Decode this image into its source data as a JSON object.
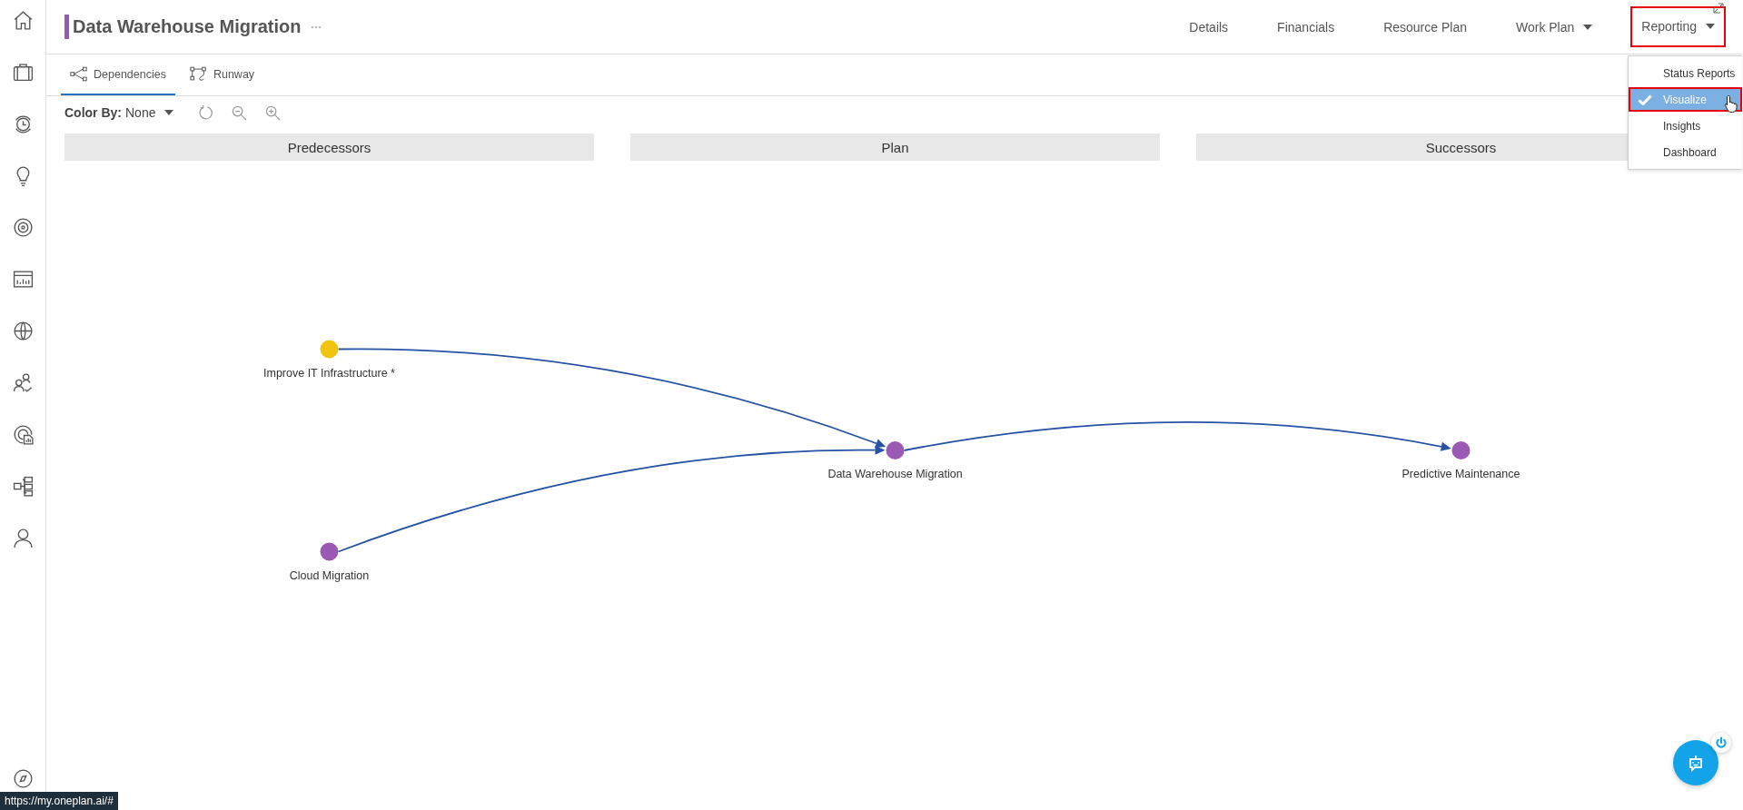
{
  "header": {
    "title": "Data Warehouse Migration"
  },
  "nav": [
    {
      "label": "Details",
      "dropdown": false,
      "highlighted": false
    },
    {
      "label": "Financials",
      "dropdown": false,
      "highlighted": false
    },
    {
      "label": "Resource Plan",
      "dropdown": false,
      "highlighted": false
    },
    {
      "label": "Work Plan",
      "dropdown": true,
      "highlighted": false
    },
    {
      "label": "Reporting",
      "dropdown": true,
      "highlighted": true
    }
  ],
  "reporting_menu": [
    {
      "label": "Status Reports",
      "selected": false,
      "highlighted": false
    },
    {
      "label": "Visualize",
      "selected": true,
      "highlighted": true
    },
    {
      "label": "Insights",
      "selected": false,
      "highlighted": false
    },
    {
      "label": "Dashboard",
      "selected": false,
      "highlighted": false
    }
  ],
  "tabs": [
    {
      "label": "Dependencies",
      "selected": true
    },
    {
      "label": "Runway",
      "selected": false
    }
  ],
  "toolbar": {
    "color_by_label": "Color By:",
    "color_by_value": "None"
  },
  "columns": [
    {
      "title": "Predecessors",
      "nodes": [
        {
          "label": "Improve IT Infrastructure *",
          "color": "#f1c40f"
        },
        {
          "label": "Cloud Migration",
          "color": "#9b59b6"
        }
      ]
    },
    {
      "title": "Plan",
      "nodes": [
        {
          "label": "Data Warehouse Migration",
          "color": "#9b59b6"
        }
      ]
    },
    {
      "title": "Successors",
      "nodes": [
        {
          "label": "Predictive Maintenance",
          "color": "#9b59b6"
        }
      ]
    }
  ],
  "status_url": "https://my.oneplan.ai/#"
}
